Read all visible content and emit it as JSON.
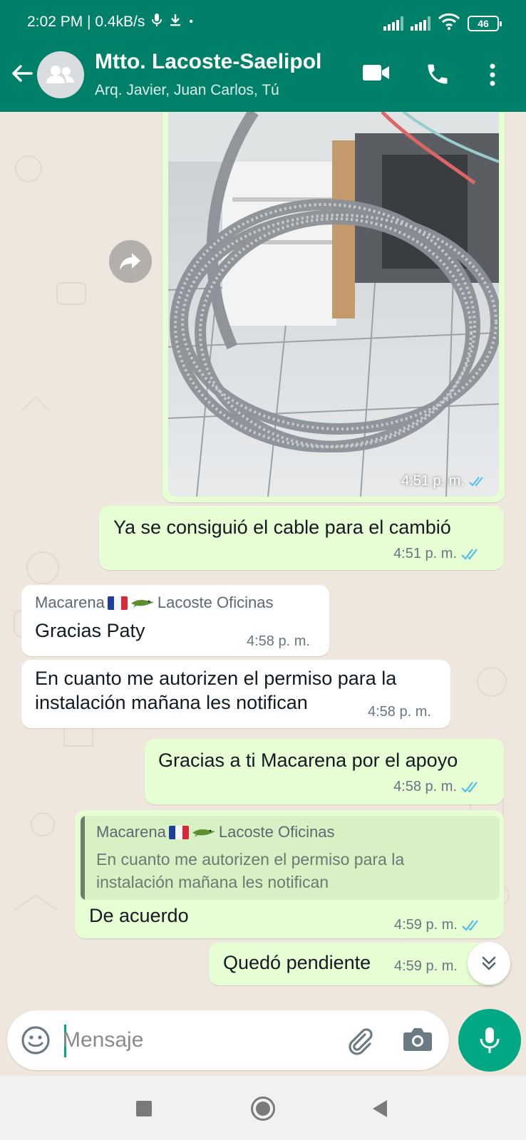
{
  "status_bar": {
    "time_speed": "2:02 PM | 0.4kB/s",
    "dot": "•",
    "battery": "46"
  },
  "header": {
    "title": "Mtto. Lacoste-Saelipol",
    "subtitle": "Arq. Javier, Juan Carlos, Tú",
    "bg_color": "#008069"
  },
  "messages": [
    {
      "type": "image",
      "direction": "out",
      "time": "4:51 p. m.",
      "status": "read"
    },
    {
      "type": "text",
      "direction": "out",
      "text": "Ya se consiguió el cable para el cambió",
      "time": "4:51 p. m.",
      "status": "read"
    },
    {
      "type": "text",
      "direction": "in",
      "sender": "Macarena",
      "sender_suffix": "Lacoste Oficinas",
      "text": "Gracias Paty",
      "time": "4:58 p. m."
    },
    {
      "type": "text",
      "direction": "in",
      "text_line1": "En cuanto me autorizen el permiso para la",
      "text_line2": "instalación mañana les notifican",
      "time": "4:58 p. m."
    },
    {
      "type": "text",
      "direction": "out",
      "text": "Gracias a ti Macarena por el apoyo",
      "time": "4:58 p. m.",
      "status": "read"
    },
    {
      "type": "reply",
      "direction": "out",
      "quoted_sender": "Macarena",
      "quoted_sender_suffix": "Lacoste Oficinas",
      "quoted_line1": "En cuanto me autorizen el permiso para la",
      "quoted_line2": "instalación mañana les notifican",
      "text": "De acuerdo",
      "time": "4:59 p. m.",
      "status": "read"
    },
    {
      "type": "text",
      "direction": "out",
      "text": "Quedó pendiente",
      "time": "4:59 p. m.",
      "status": "sent"
    }
  ],
  "composer": {
    "placeholder": "Mensaje"
  },
  "colors": {
    "outgoing_bubble": "#e7fdd3",
    "incoming_bubble": "#ffffff",
    "read_ticks": "#53bdeb",
    "accent": "#00a884",
    "chat_bg": "#efe7de"
  }
}
